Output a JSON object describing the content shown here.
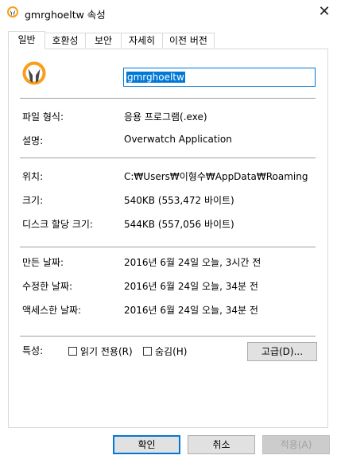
{
  "window": {
    "title": "gmrghoeltw 속성",
    "close_glyph": "✕",
    "icon": "overwatch-logo-icon"
  },
  "tabs": [
    {
      "label": "일반",
      "active": true
    },
    {
      "label": "호환성",
      "active": false
    },
    {
      "label": "보안",
      "active": false
    },
    {
      "label": "자세히",
      "active": false
    },
    {
      "label": "이전 버전",
      "active": false
    }
  ],
  "general": {
    "file_name": "gmrghoeltw",
    "file_type_label": "파일 형식:",
    "file_type_value": "응용 프로그램(.exe)",
    "description_label": "설명:",
    "description_value": "Overwatch Application",
    "location_label": "위치:",
    "location_value": "C:₩Users₩이형수₩AppData₩Roaming",
    "size_label": "크기:",
    "size_value": "540KB (553,472 바이트)",
    "size_on_disk_label": "디스크 할당 크기:",
    "size_on_disk_value": "544KB (557,056 바이트)",
    "created_label": "만든 날짜:",
    "created_value": "2016년 6월 24일 오늘, 3시간 전",
    "modified_label": "수정한 날짜:",
    "modified_value": "2016년 6월 24일 오늘, 34분 전",
    "accessed_label": "액세스한 날짜:",
    "accessed_value": "2016년 6월 24일 오늘, 34분 전",
    "attributes_label": "특성:",
    "readonly_label": "읽기 전용(R)",
    "hidden_label": "숨김(H)",
    "advanced_label": "고급(D)..."
  },
  "buttons": {
    "ok": "확인",
    "cancel": "취소",
    "apply": "적용(A)"
  },
  "colors": {
    "accent": "#0078d7",
    "overwatch_orange": "#f99e1a",
    "overwatch_gray": "#43484c"
  }
}
